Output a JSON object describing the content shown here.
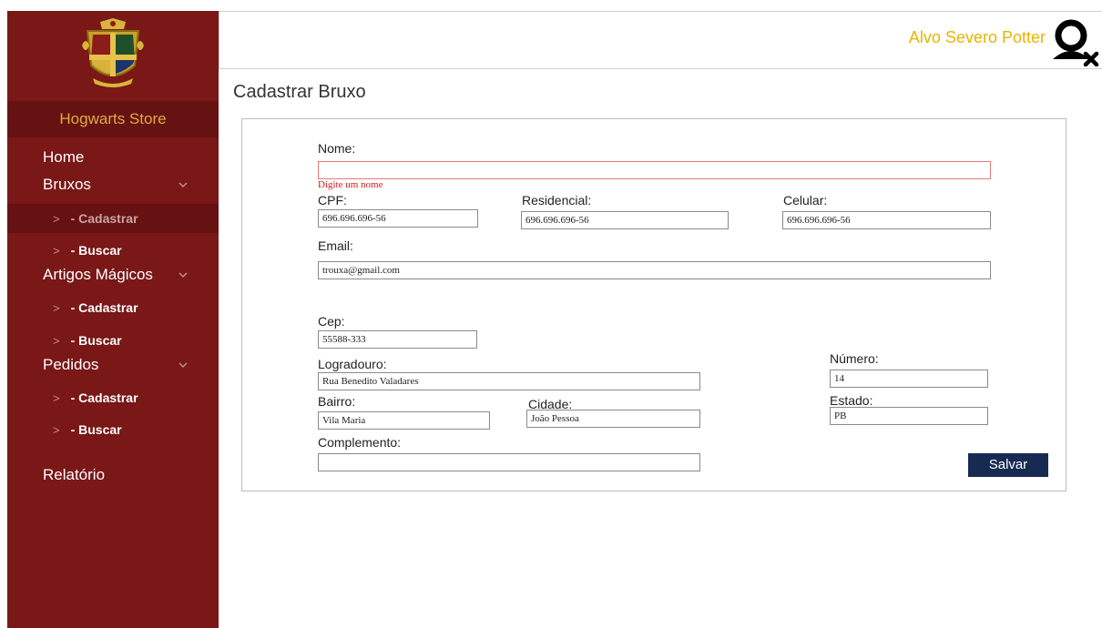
{
  "sidebar": {
    "brand": "Hogwarts Store",
    "home": "Home",
    "groups": [
      {
        "label": "Bruxos",
        "items": [
          "- Cadastrar",
          "- Buscar"
        ]
      },
      {
        "label": "Artigos Mágicos",
        "items": [
          "- Cadastrar",
          "- Buscar"
        ]
      },
      {
        "label": "Pedidos",
        "items": [
          "- Cadastrar",
          "- Buscar"
        ]
      }
    ],
    "report": "Relatório",
    "sub_arrow": ">"
  },
  "header": {
    "username": "Alvo Severo Potter"
  },
  "page": {
    "title": "Cadastrar Bruxo"
  },
  "form": {
    "nome": {
      "label": "Nome:",
      "value": "",
      "error": "Digite um nome"
    },
    "cpf": {
      "label": "CPF:",
      "value": "696.696.696-56"
    },
    "residencial": {
      "label": "Residencial:",
      "value": "696.696.696-56"
    },
    "celular": {
      "label": "Celular:",
      "value": "696.696.696-56"
    },
    "email": {
      "label": "Email:",
      "value": "trouxa@gmail.com"
    },
    "cep": {
      "label": "Cep:",
      "value": "55588-333"
    },
    "logradouro": {
      "label": "Logradouro:",
      "value": "Rua Benedito Valadares"
    },
    "numero": {
      "label": "Número:",
      "value": "14"
    },
    "bairro": {
      "label": "Bairro:",
      "value": "Vila Maria"
    },
    "cidade": {
      "label": "Cidade:",
      "value": "João Pessoa"
    },
    "estado": {
      "label": "Estado:",
      "value": "PB"
    },
    "complemento": {
      "label": "Complemento:",
      "value": ""
    },
    "save_label": "Salvar"
  },
  "colors": {
    "sidebar_bg": "#7a1717",
    "brand_bg": "#661212",
    "brand_text": "#e0ab3e",
    "username_text": "#e8b400",
    "error_text": "#d01a1a",
    "button_bg": "#172a52"
  }
}
